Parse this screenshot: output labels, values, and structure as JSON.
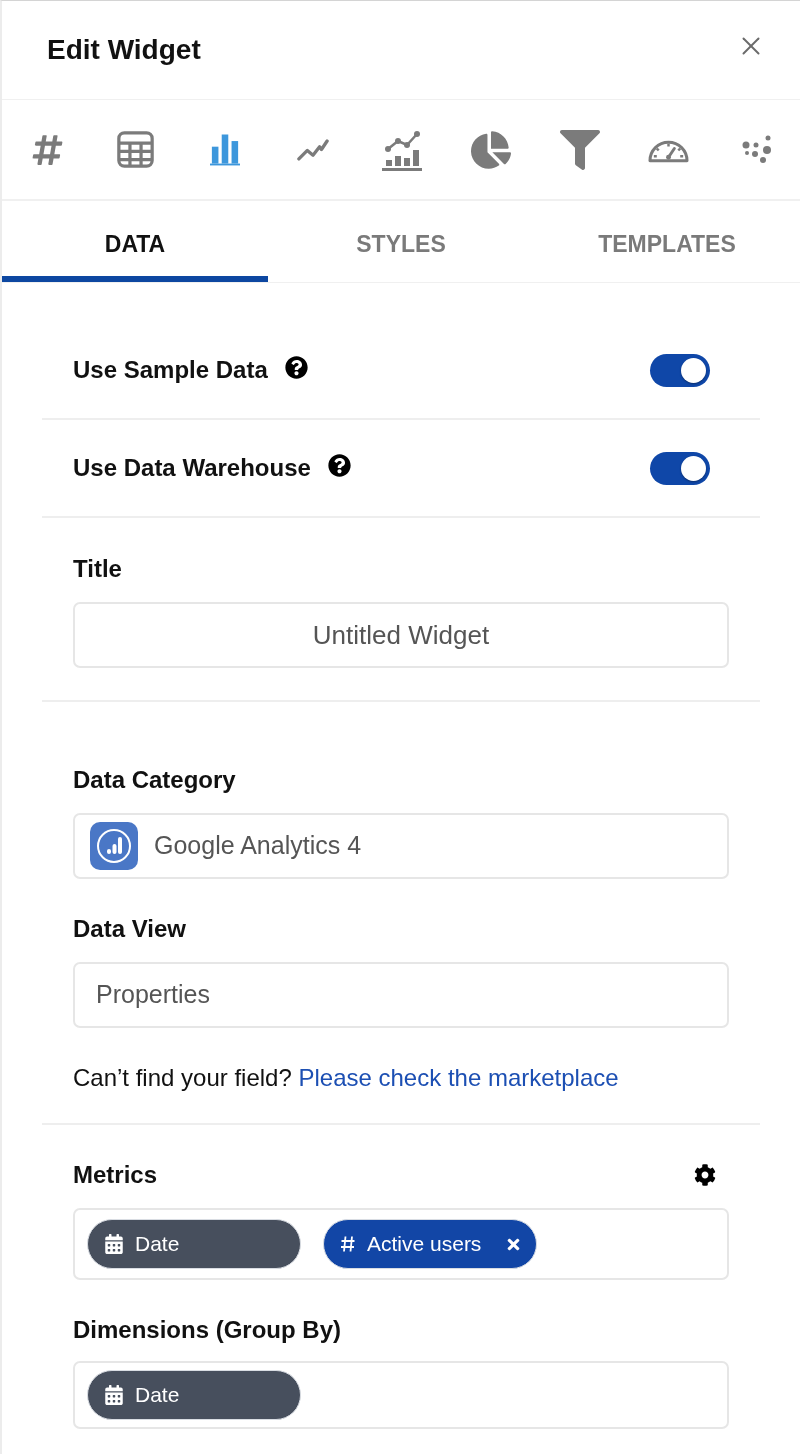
{
  "header": {
    "title": "Edit Widget"
  },
  "chart_types": [
    {
      "kind": "number",
      "selected": false
    },
    {
      "kind": "table",
      "selected": false
    },
    {
      "kind": "bar",
      "selected": true
    },
    {
      "kind": "line",
      "selected": false
    },
    {
      "kind": "combo",
      "selected": false
    },
    {
      "kind": "pie",
      "selected": false
    },
    {
      "kind": "funnel",
      "selected": false
    },
    {
      "kind": "gauge",
      "selected": false
    },
    {
      "kind": "scatter",
      "selected": false
    }
  ],
  "tabs": [
    {
      "label": "DATA",
      "selected": true
    },
    {
      "label": "STYLES",
      "selected": false
    },
    {
      "label": "TEMPLATES",
      "selected": false
    }
  ],
  "toggles": [
    {
      "label": "Use Sample Data",
      "on": true
    },
    {
      "label": "Use Data Warehouse",
      "on": true
    }
  ],
  "title_field": {
    "label": "Title",
    "value": "Untitled Widget"
  },
  "data_category": {
    "label": "Data Category",
    "value": "Google Analytics 4"
  },
  "data_view": {
    "label": "Data View",
    "value": "Properties"
  },
  "field_help": {
    "text": "Can’t find your field?",
    "link": "Please check the marketplace"
  },
  "metrics": {
    "label": "Metrics",
    "chips": [
      {
        "kind": "date",
        "label": "Date",
        "removable": false
      },
      {
        "kind": "number",
        "label": "Active users",
        "removable": true
      }
    ]
  },
  "dimensions": {
    "label": "Dimensions (Group By)",
    "chips": [
      {
        "kind": "date",
        "label": "Date",
        "removable": false
      }
    ]
  }
}
